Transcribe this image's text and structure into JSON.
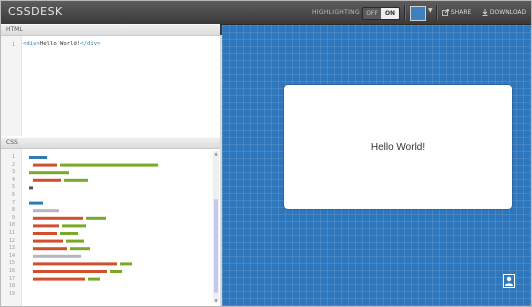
{
  "app": {
    "logo": "CSSDESK"
  },
  "toolbar": {
    "highlighting_label": "HIGHLIGHTING",
    "toggle_off": "OFF",
    "toggle_on": "ON",
    "share_label": "SHARE",
    "download_label": "DOWNLOAD",
    "swatch_color": "#3d80c1"
  },
  "html_panel": {
    "title": "HTML",
    "line_numbers": [
      "1"
    ],
    "code_line": {
      "open_tag": "<div>",
      "text": "Hello World!",
      "close_tag": "</div>"
    }
  },
  "css_panel": {
    "title": "CSS",
    "line_numbers": [
      "1",
      "2",
      "3",
      "4",
      "5",
      "6",
      "7",
      "8",
      "9",
      "10",
      "11",
      "12",
      "13",
      "14",
      "15",
      "16",
      "17",
      "18",
      "19"
    ]
  },
  "preview": {
    "text": "Hello World!",
    "background_color": "#2f77bd"
  }
}
